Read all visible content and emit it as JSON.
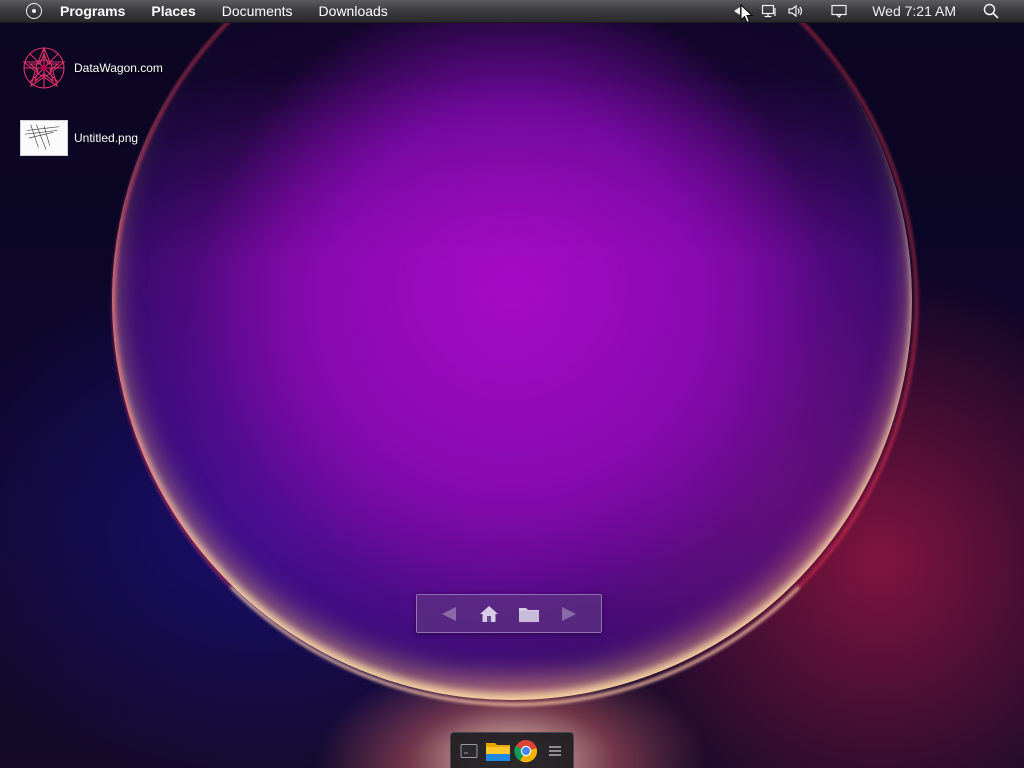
{
  "menubar": {
    "logo_icon": "circle-dot-icon",
    "menus": [
      {
        "label": "Programs",
        "bold": true
      },
      {
        "label": "Places",
        "bold": true
      },
      {
        "label": "Documents",
        "bold": false
      },
      {
        "label": "Downloads",
        "bold": false
      }
    ],
    "tray": {
      "icons": [
        "tray-expand-arrow-icon",
        "network-icon",
        "volume-icon",
        "notification-icon",
        "search-icon"
      ],
      "clock": "Wed 7:21 AM"
    }
  },
  "desktop": {
    "icons": [
      {
        "label": "DataWagon.com",
        "icon": "datawagon-logo-icon"
      },
      {
        "label": "Untitled.png",
        "icon": "image-thumbnail-icon"
      }
    ]
  },
  "nav_panel": {
    "buttons": [
      "back-arrow-icon",
      "home-icon",
      "folder-icon",
      "forward-arrow-icon"
    ]
  },
  "dock": {
    "items": [
      "terminal-icon",
      "file-manager-folder-icon",
      "chrome-browser-icon",
      "menu-icon"
    ]
  },
  "colors": {
    "menubar": "#3a3a3f",
    "background": "#0d0628",
    "sphere": "#a010c0",
    "rim_glow": "#ffc8a0"
  }
}
